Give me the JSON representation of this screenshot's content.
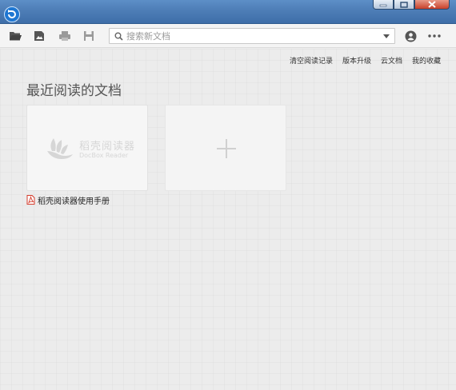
{
  "window": {
    "app_icon": "docbox-app-icon",
    "controls": [
      "minimize-icon",
      "maximize-icon",
      "close-icon"
    ]
  },
  "toolbar": {
    "icons": [
      "open-folder-icon",
      "import-image-icon",
      "print-icon",
      "save-icon"
    ],
    "search": {
      "placeholder": "搜索新文档",
      "value": ""
    },
    "right_icons": [
      "user-icon",
      "more-icon"
    ]
  },
  "links": {
    "clear_history": "清空阅读记录",
    "upgrade": "版本升级",
    "cloud_docs": "云文档",
    "favorites": "我的收藏"
  },
  "recent": {
    "title": "最近阅读的文档",
    "documents": [
      {
        "name": "稻壳阅读器使用手册",
        "type": "pdf",
        "thumb_title": "稻壳阅读器",
        "thumb_subtitle": "DocBox Reader"
      }
    ],
    "add_icon": "plus-icon"
  },
  "colors": {
    "titlebar": "#4f7fb8",
    "background": "#ececec",
    "pdf_red": "#d43c2c"
  }
}
